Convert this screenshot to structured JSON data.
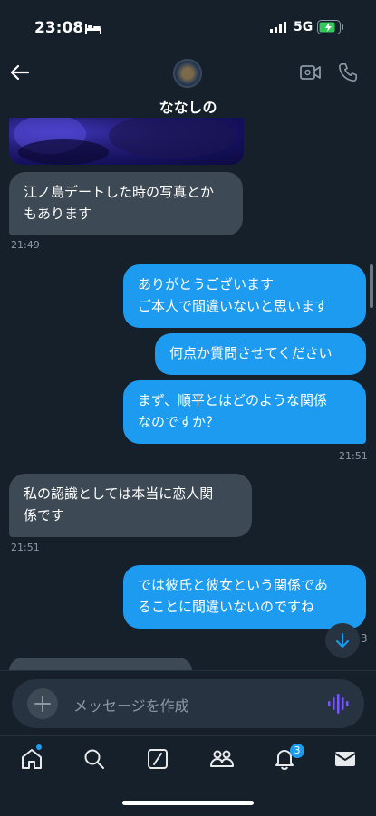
{
  "status": {
    "time": "23:08",
    "network": "5G"
  },
  "header": {
    "name": "ななしの"
  },
  "messages": {
    "m1": "江ノ島デートした時の写真とか\nもあります",
    "t1": "21:49",
    "m2": "ありがとうございます\nご本人で間違いないと思います",
    "m3": "何点か質問させてください",
    "m4": "まず、順平とはどのような関係\nなのですか？",
    "t2": "21:51",
    "m5": "私の認識としては本当に恋人関\n係です",
    "t3": "21:51",
    "m6": "では彼氏と彼女という関係であ\nることに間違いないのですね",
    "partial_count": "3"
  },
  "composer": {
    "placeholder": "メッセージを作成"
  },
  "tabbar": {
    "notif_badge": "3"
  },
  "colors": {
    "bg": "#15202b",
    "accent": "#1d9bf0",
    "incoming": "#3d4954"
  }
}
